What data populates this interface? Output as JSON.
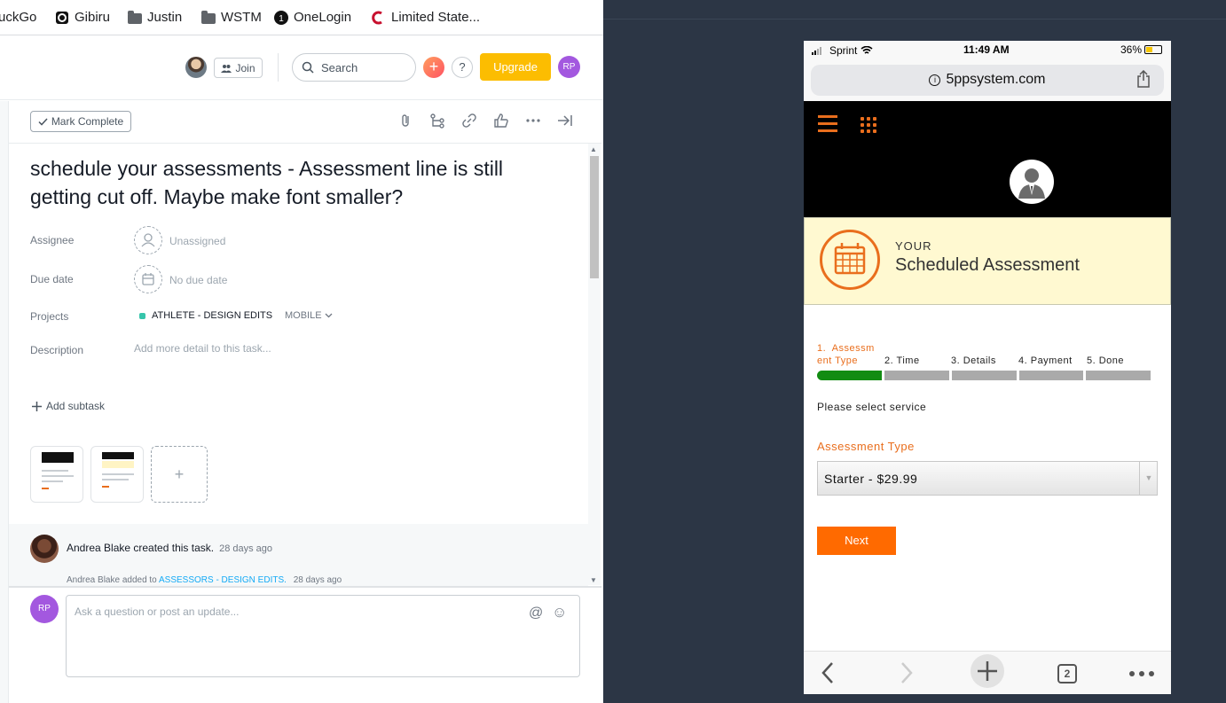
{
  "bookmarks": [
    {
      "label": "uckGo",
      "icon": "duckduckgo-icon"
    },
    {
      "label": "Gibiru",
      "icon": "gibiru-icon"
    },
    {
      "label": "Justin",
      "icon": "folder-icon"
    },
    {
      "label": "WSTM",
      "icon": "folder-icon"
    },
    {
      "label": "OneLogin",
      "icon": "onelogin-icon"
    },
    {
      "label": "Limited State...",
      "icon": "limited-state-icon"
    }
  ],
  "topbar": {
    "join_label": "Join",
    "search_placeholder": "Search",
    "help_label": "?",
    "plus_label": "+",
    "upgrade_label": "Upgrade",
    "user_initials": "RP"
  },
  "task": {
    "mark_complete_label": "Mark Complete",
    "title": "schedule your assessments - Assessment line is still getting cut off. Maybe make font smaller?",
    "assignee_label": "Assignee",
    "assignee_value": "Unassigned",
    "due_label": "Due date",
    "due_value": "No due date",
    "projects_label": "Projects",
    "project_name": "ATHLETE - DESIGN EDITS",
    "project_section": "MOBILE",
    "description_label": "Description",
    "description_placeholder": "Add more detail to this task...",
    "add_subtask_label": "Add subtask",
    "add_attachment_label": "+"
  },
  "activity": {
    "creator_name": "Andrea Blake",
    "created_text": "Andrea Blake created this task.",
    "created_ago": "28 days ago",
    "added_prefix": "Andrea Blake added to",
    "added_project": "ASSESSORS - DESIGN EDITS.",
    "added_ago": "28 days ago"
  },
  "comment": {
    "user_initials": "RP",
    "placeholder": "Ask a question or post an update..."
  },
  "phone": {
    "carrier": "Sprint",
    "time": "11:49 AM",
    "battery": "36%",
    "url": "5ppsystem.com",
    "banner_small": "YOUR",
    "banner_big": "Scheduled Assessment",
    "steps": [
      {
        "label": "1.  Assessm\nent Type",
        "active": true
      },
      {
        "label": "2.  Time",
        "active": false
      },
      {
        "label": "3.  Details",
        "active": false
      },
      {
        "label": "4.  Payment",
        "active": false
      },
      {
        "label": "5.  Done",
        "active": false
      }
    ],
    "select_service_text": "Please select service",
    "assessment_type_label": "Assessment Type",
    "assessment_type_value": "Starter - $29.99",
    "next_label": "Next",
    "tabs_count": "2",
    "accent_color": "#e96e1d",
    "progress_color": "#128c12"
  }
}
